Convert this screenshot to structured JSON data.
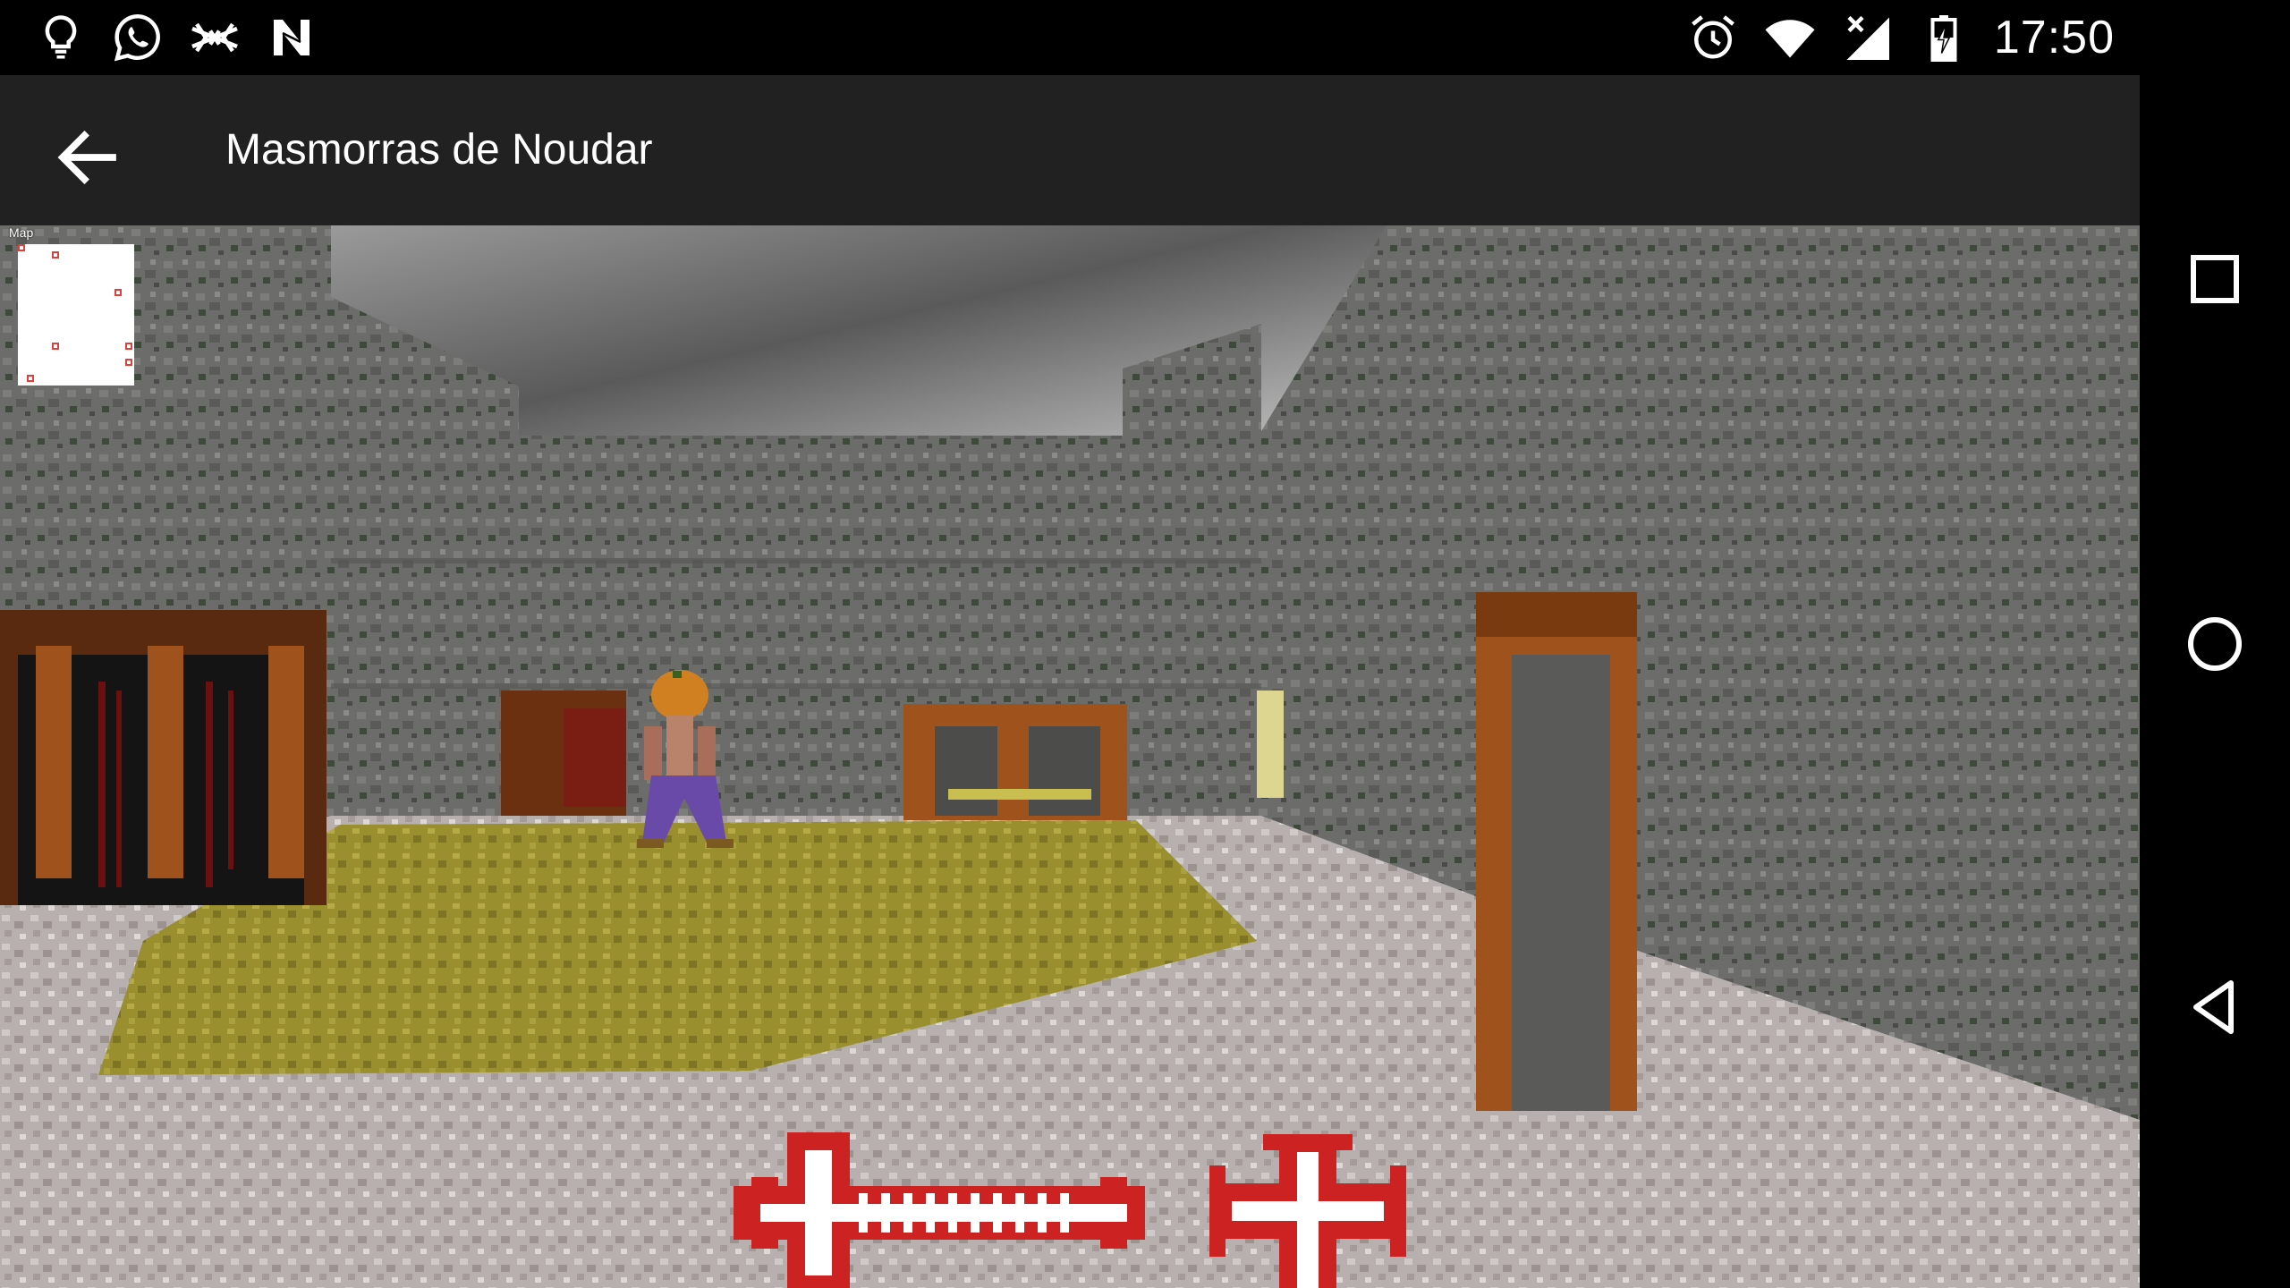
{
  "status_bar": {
    "time": "17:50",
    "left_icons": [
      "lightbulb-icon",
      "whatsapp-icon",
      "tangled-icon",
      "n-app-icon"
    ],
    "right_icons": [
      "alarm-icon",
      "wifi-icon",
      "cell-signal-icon",
      "battery-charging-icon"
    ]
  },
  "app_bar": {
    "title": "Masmorras de Noudar",
    "back_icon": "arrow-left-icon"
  },
  "game": {
    "minimap_label": "Map",
    "minimap_markers": 7,
    "hud_items": [
      "sword-weapon-icon",
      "cross-of-christ-icon"
    ],
    "colors": {
      "sky": "#8a8a8a",
      "wall": "#6e6e6c",
      "floor": "#b9b2b0",
      "moss_carpet": "#9b9030",
      "door_wood": "#a0521c",
      "hud_red": "#cc2222"
    }
  },
  "nav_bar": {
    "buttons": [
      "recents-square-icon",
      "home-circle-icon",
      "back-triangle-icon"
    ]
  }
}
